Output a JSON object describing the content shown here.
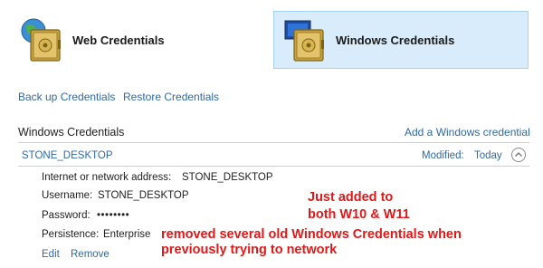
{
  "tiles": {
    "web": {
      "label": "Web Credentials"
    },
    "windows": {
      "label": "Windows Credentials"
    }
  },
  "actions": {
    "backup": "Back up Credentials",
    "restore": "Restore Credentials"
  },
  "section": {
    "title": "Windows Credentials",
    "add_link": "Add a Windows credential"
  },
  "credential": {
    "name": "STONE_DESKTOP",
    "modified_label": "Modified:",
    "modified_value": "Today",
    "address_label": "Internet or network address:",
    "address_value": "STONE_DESKTOP",
    "username_label": "Username:",
    "username_value": "STONE_DESKTOP",
    "password_label": "Password:",
    "password_value": "••••••••",
    "persistence_label": "Persistence:",
    "persistence_value": "Enterprise",
    "edit": "Edit",
    "remove": "Remove"
  },
  "annotations": {
    "line1": "Just added to",
    "line2": "both W10 & W11",
    "line3": "removed several old Windows Credentials when",
    "line4": "previously trying to network"
  },
  "colors": {
    "link": "#2d6aa7",
    "annotation": "#e01818",
    "selected_tile_bg": "#d9ecfb"
  }
}
